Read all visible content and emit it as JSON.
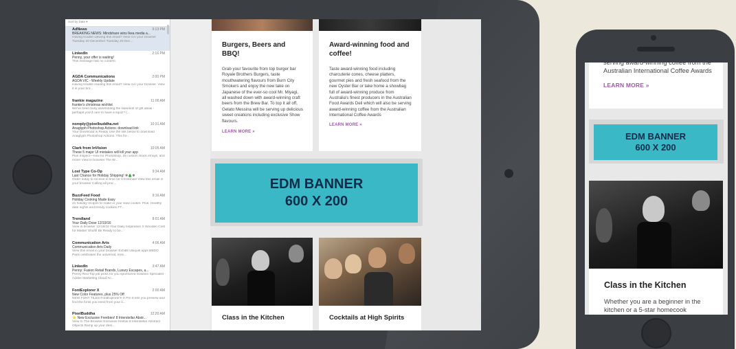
{
  "mail": {
    "sort_label": "Sort by Date ▾",
    "items": [
      {
        "sender": "AdNews",
        "time": "3:13 PM",
        "subject": "BREAKING NEWS: Mindshare wins Ikea media a...",
        "preview": "Having trouble viewing this email? View it in your browser Tuesday 20 December Tuesday 20 Dec..."
      },
      {
        "sender": "LinkedIn",
        "time": "2:16 PM",
        "subject": "Penny, your offer is waiting!",
        "preview": "This message has no content."
      },
      {
        "sender": "AGDA Communications",
        "time": "2:00 PM",
        "subject": "AGDA VIC - Weekly Update",
        "preview": "Having trouble reading this email? View it in your browser. View it in your bro..."
      },
      {
        "sender": "frankie magazine",
        "time": "11:00 AM",
        "subject": "frankie's christmas wishlist",
        "preview": "We've been busy assembling the sweetest of gift ideas - perhaps you'd care to have a squiz? (..."
      },
      {
        "sender": "noreply@pixelbuddha.net",
        "time": "10:31 AM",
        "subject": "Anaglyph Photoshop Actions: download link",
        "preview": "Your Download is Ready Use the link below to download Anaglyph Photoshop Actions. This fre..."
      },
      {
        "sender": "Clark from InVision",
        "time": "10:05 AM",
        "subject": "These 5 major UI mistakes will kill your app",
        "preview": "Plus Inspect—now for Photoshop, 25 custom Slack emojis, and more! View in browser The W..."
      },
      {
        "sender": "Lost Type Co-Op",
        "time": "9:34 AM",
        "subject": "Last Chance for Holiday Shipping! ❄🎄❄",
        "preview": "Order today to receive in time for Christmas! View this email in your browser Calling all proc..."
      },
      {
        "sender": "BuzzFeed Food",
        "time": "9:16 AM",
        "subject": "Holiday Cooking Made Easy",
        "preview": "21 holiday recipes to make in your slow cooker. Plus: Healthy date nights and trendy cookies FT..."
      },
      {
        "sender": "Trendland",
        "time": "8:01 AM",
        "subject": "Your Daily Dose 12/19/16",
        "preview": "View in browser 12/19/16 Your Daily Inspiration X Wooden Cost for Master Shuhll Be Ready to be..."
      },
      {
        "sender": "Communication Arts",
        "time": "4:06 AM",
        "subject": "Communication Arts Daily",
        "preview": "View this email in your browser Exhibit Ubiquiti apps BBDO Paris celebrates the universal, irres..."
      },
      {
        "sender": "LinkedIn",
        "time": "3:47 AM",
        "subject": "Penny: Fusion Retail Brands, Luxury Escapes, a...",
        "preview": "Penny Red Top job picks for you sponsored Solution Specialist - Adobe Marketing Cloud Ac..."
      },
      {
        "sender": "FontExplorer X",
        "time": "2:00 AM",
        "subject": "New Color Features, plus 25% Off",
        "preview": "NEW FONT TILES FontExplorer® X Pro 6 lets you preview and find the fonts you need from your li..."
      },
      {
        "sender": "PixelBuddha",
        "time": "12:20 AM",
        "subject": "⭐ New Exclusive Freebies! 8 Interstellar Abstr...",
        "preview": "View In The Browser Exclusive freebie 8 Interstellar Abstract Objects Ramp up your desi..."
      }
    ]
  },
  "email": {
    "card1": {
      "title": "Burgers, Beers and BBQ!",
      "body": "Grab your favourite from top burger bar Royale Brothers Burgers, taste mouthwatering flavours from Burn City Smokers and enjoy the new take on Japanese of the ever-so cool Mr. Miyagi, all washed down with award-winning craft beers from the Brew Bar. To top it all off, Gelato Messina will be serving up delicious sweet creations including exclusive Show flavours.",
      "link": "LEARN MORE »"
    },
    "card2": {
      "title": "Award-winning food and coffee!",
      "body": "Taste award-winning food including charcuterie cones, cheese platters, gourmet pies and fresh seafood from the new Oyster Bar or take home a showbag full of award-winning produce from Australia's finest producers in the Australian Food Awards Deli which will also be serving award-winning coffee from the Australian International Coffee Awards",
      "link": "LEARN MORE »"
    },
    "banner": {
      "line1": "EDM BANNER",
      "line2": "600 X 200"
    },
    "card3": {
      "title": "Class in the Kitchen"
    },
    "card4": {
      "title": "Cocktails at High Spirits"
    }
  },
  "phone": {
    "top_text": "serving award-winning coffee from the Australian International Coffee Awards",
    "link": "LEARN MORE »",
    "banner": {
      "line1": "EDM BANNER",
      "line2": "600 X 200"
    },
    "card_title": "Class in the Kitchen",
    "card_body": "Whether you are a beginner in the kitchen or a 5-star homecook"
  },
  "colors": {
    "banner": "#3ab8c6",
    "banner_text": "#0f2d4a",
    "link": "#9b59a6",
    "device": "#3b3e42",
    "background": "#ece9dc"
  }
}
